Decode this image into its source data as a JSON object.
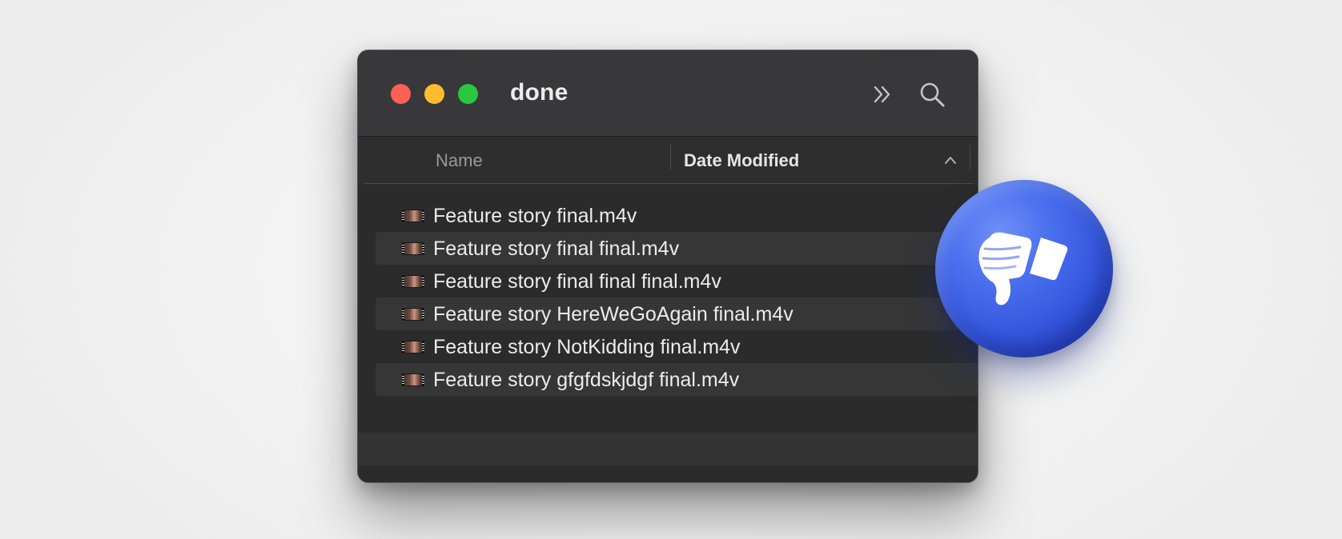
{
  "window": {
    "title": "done",
    "traffic_lights": {
      "close_color": "#fe5f57",
      "minimize_color": "#febc2e",
      "zoom_color": "#28c840"
    },
    "toolbar_icons": [
      "more-chevrons-icon",
      "search-icon"
    ]
  },
  "columns": {
    "name_label": "Name",
    "date_label": "Date Modified",
    "sort": "ascending"
  },
  "files": [
    {
      "name": "Feature story final.m4v",
      "icon": "video-file-icon"
    },
    {
      "name": "Feature story final final.m4v",
      "icon": "video-file-icon"
    },
    {
      "name": "Feature story final final final.m4v",
      "icon": "video-file-icon"
    },
    {
      "name": "Feature story HereWeGoAgain final.m4v",
      "icon": "video-file-icon"
    },
    {
      "name": "Feature story NotKidding final.m4v",
      "icon": "video-file-icon"
    },
    {
      "name": "Feature story gfgfdskjdgf final.m4v",
      "icon": "video-file-icon"
    }
  ],
  "badge": {
    "icon": "thumbs-down-icon",
    "color": "#3a5ce6"
  }
}
